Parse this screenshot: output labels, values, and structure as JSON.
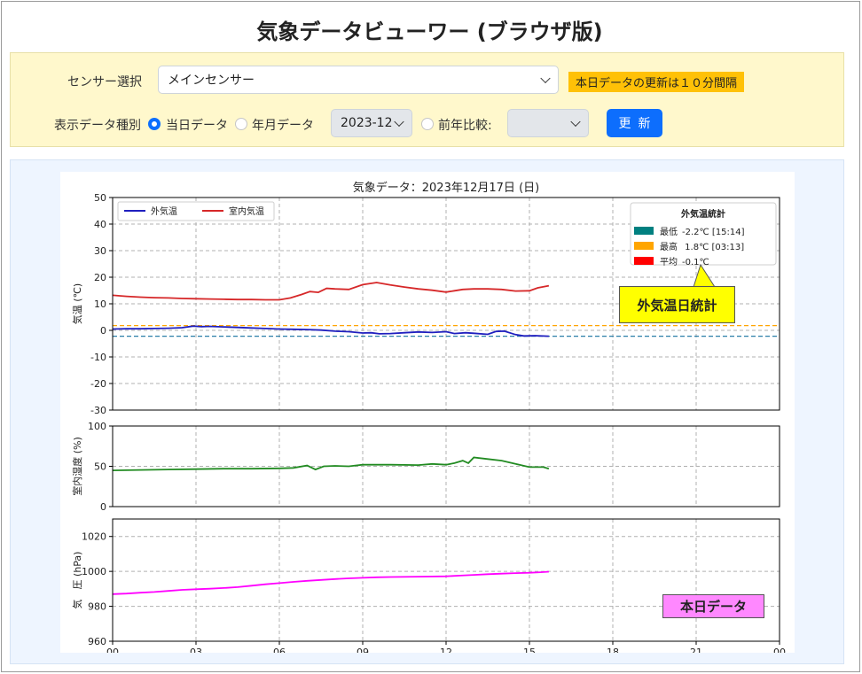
{
  "app": {
    "title": "気象データビューワー (ブラウザ版)"
  },
  "controls": {
    "sensor_label": "センサー選択",
    "sensor_value": "メインセンサー",
    "update_note": "本日データの更新は１０分間隔",
    "type_label": "表示データ種別",
    "radio_today": "当日データ",
    "radio_month": "年月データ",
    "month_value": "2023-12",
    "radio_prev": "前年比較:",
    "prev_value": "",
    "refresh_label": "更新",
    "selected_radio": "today"
  },
  "annotations": {
    "stats_callout": "外気温日統計",
    "today_tag": "本日データ"
  },
  "chart_data": [
    {
      "type": "line",
      "title": "気象データ：2023年12月17日 (日)",
      "ylabel": "気温 (℃)",
      "ylim": [
        -30,
        50
      ],
      "yticks": [
        -30,
        -20,
        -10,
        0,
        10,
        20,
        30,
        40,
        50
      ],
      "xlim": [
        0,
        24
      ],
      "grid": true,
      "legend_position": "top-left",
      "series": [
        {
          "name": "外気温",
          "color": "#1f1fbf",
          "x": [
            0,
            0.5,
            1,
            1.5,
            2,
            2.5,
            2.9,
            3.2,
            3.5,
            4,
            4.5,
            5,
            5.5,
            6,
            6.5,
            7,
            7.5,
            8,
            8.5,
            9,
            9.3,
            9.6,
            10,
            10.5,
            11,
            11.5,
            12,
            12.3,
            12.7,
            13,
            13.5,
            13.8,
            14.1,
            14.5,
            14.8,
            15.2,
            15.7
          ],
          "y": [
            0.5,
            0.6,
            0.6,
            0.7,
            0.8,
            1.0,
            1.6,
            1.4,
            1.5,
            1.3,
            1.1,
            0.9,
            0.7,
            0.5,
            0.4,
            0.3,
            0.1,
            -0.3,
            -0.5,
            -1.0,
            -0.9,
            -1.3,
            -1.2,
            -0.9,
            -0.6,
            -0.8,
            -0.5,
            -1.2,
            -0.9,
            -1.1,
            -1.5,
            -0.4,
            -0.3,
            -1.6,
            -2.1,
            -2.0,
            -2.2
          ]
        },
        {
          "name": "室内気温",
          "color": "#d62728",
          "x": [
            0,
            0.5,
            1,
            1.5,
            2,
            2.5,
            3,
            3.5,
            4,
            4.5,
            5,
            5.5,
            6,
            6.4,
            6.8,
            7.1,
            7.4,
            7.7,
            8,
            8.5,
            9,
            9.5,
            10,
            10.5,
            11,
            11.5,
            12,
            12.3,
            12.6,
            13,
            13.5,
            14,
            14.5,
            15,
            15.3,
            15.7
          ],
          "y": [
            13.2,
            12.8,
            12.5,
            12.3,
            12.2,
            12.0,
            11.9,
            11.8,
            11.7,
            11.6,
            11.6,
            11.5,
            11.5,
            12.2,
            13.5,
            14.6,
            14.3,
            15.8,
            15.6,
            15.4,
            17.2,
            18.0,
            17.1,
            16.3,
            15.6,
            15.1,
            14.4,
            14.9,
            15.4,
            15.6,
            15.6,
            15.4,
            14.8,
            14.9,
            16.0,
            16.8
          ]
        }
      ],
      "reference_lines": [
        {
          "name": "最高",
          "y": 1.8,
          "color": "#ffa500"
        },
        {
          "name": "最低",
          "y": -2.2,
          "color": "#2a7fa8"
        }
      ],
      "stats_box": {
        "title": "外気温統計",
        "rows": [
          {
            "label": "最低",
            "value": "-2.2℃",
            "time": "[15:14]",
            "color": "#008080"
          },
          {
            "label": "最高",
            "value": " 1.8℃",
            "time": "[03:13]",
            "color": "#ffa500"
          },
          {
            "label": "平均",
            "value": "-0.1℃",
            "time": "",
            "color": "#ff0000"
          }
        ]
      }
    },
    {
      "type": "line",
      "ylabel": "室内湿度 (%)",
      "ylim": [
        0,
        100
      ],
      "yticks": [
        0,
        50,
        100
      ],
      "xlim": [
        0,
        24
      ],
      "grid": true,
      "series": [
        {
          "color": "#228b22",
          "x": [
            0,
            1,
            2,
            3,
            4,
            5,
            6,
            6.5,
            7,
            7.3,
            7.6,
            8,
            8.5,
            9,
            10,
            11,
            11.5,
            12,
            12.3,
            12.6,
            12.8,
            13,
            13.5,
            14,
            14.5,
            15,
            15.5,
            15.7
          ],
          "y": [
            45,
            45.5,
            46,
            46.5,
            47,
            47,
            47.5,
            48,
            51,
            46,
            50,
            50.5,
            50,
            52,
            52,
            51.5,
            53,
            52,
            54,
            57,
            54,
            61,
            59,
            57,
            53,
            49,
            49,
            47
          ]
        }
      ]
    },
    {
      "type": "line",
      "ylabel": "気　圧 (hPa)",
      "ylim": [
        960,
        1030
      ],
      "yticks": [
        960,
        980,
        1000,
        1020
      ],
      "xlim": [
        0,
        24
      ],
      "xticks": [
        "00",
        "03",
        "06",
        "09",
        "12",
        "15",
        "18",
        "21",
        "00"
      ],
      "grid": true,
      "series": [
        {
          "color": "#ff00ff",
          "x": [
            0,
            0.5,
            1,
            1.5,
            2,
            2.5,
            3,
            3.5,
            4,
            4.5,
            5,
            5.5,
            6,
            6.5,
            7,
            7.5,
            8,
            8.5,
            9,
            9.5,
            10,
            11,
            12,
            12.5,
            13,
            13.5,
            14,
            14.5,
            15,
            15.4,
            15.7
          ],
          "y": [
            987,
            987.3,
            987.8,
            988.2,
            988.8,
            989.4,
            989.8,
            990.1,
            990.5,
            991,
            991.8,
            992.6,
            993.3,
            994,
            994.6,
            995.1,
            995.6,
            996,
            996.3,
            996.6,
            996.8,
            997,
            997.2,
            997.6,
            998,
            998.4,
            998.7,
            999,
            999.2,
            999.5,
            999.8
          ]
        }
      ]
    }
  ]
}
